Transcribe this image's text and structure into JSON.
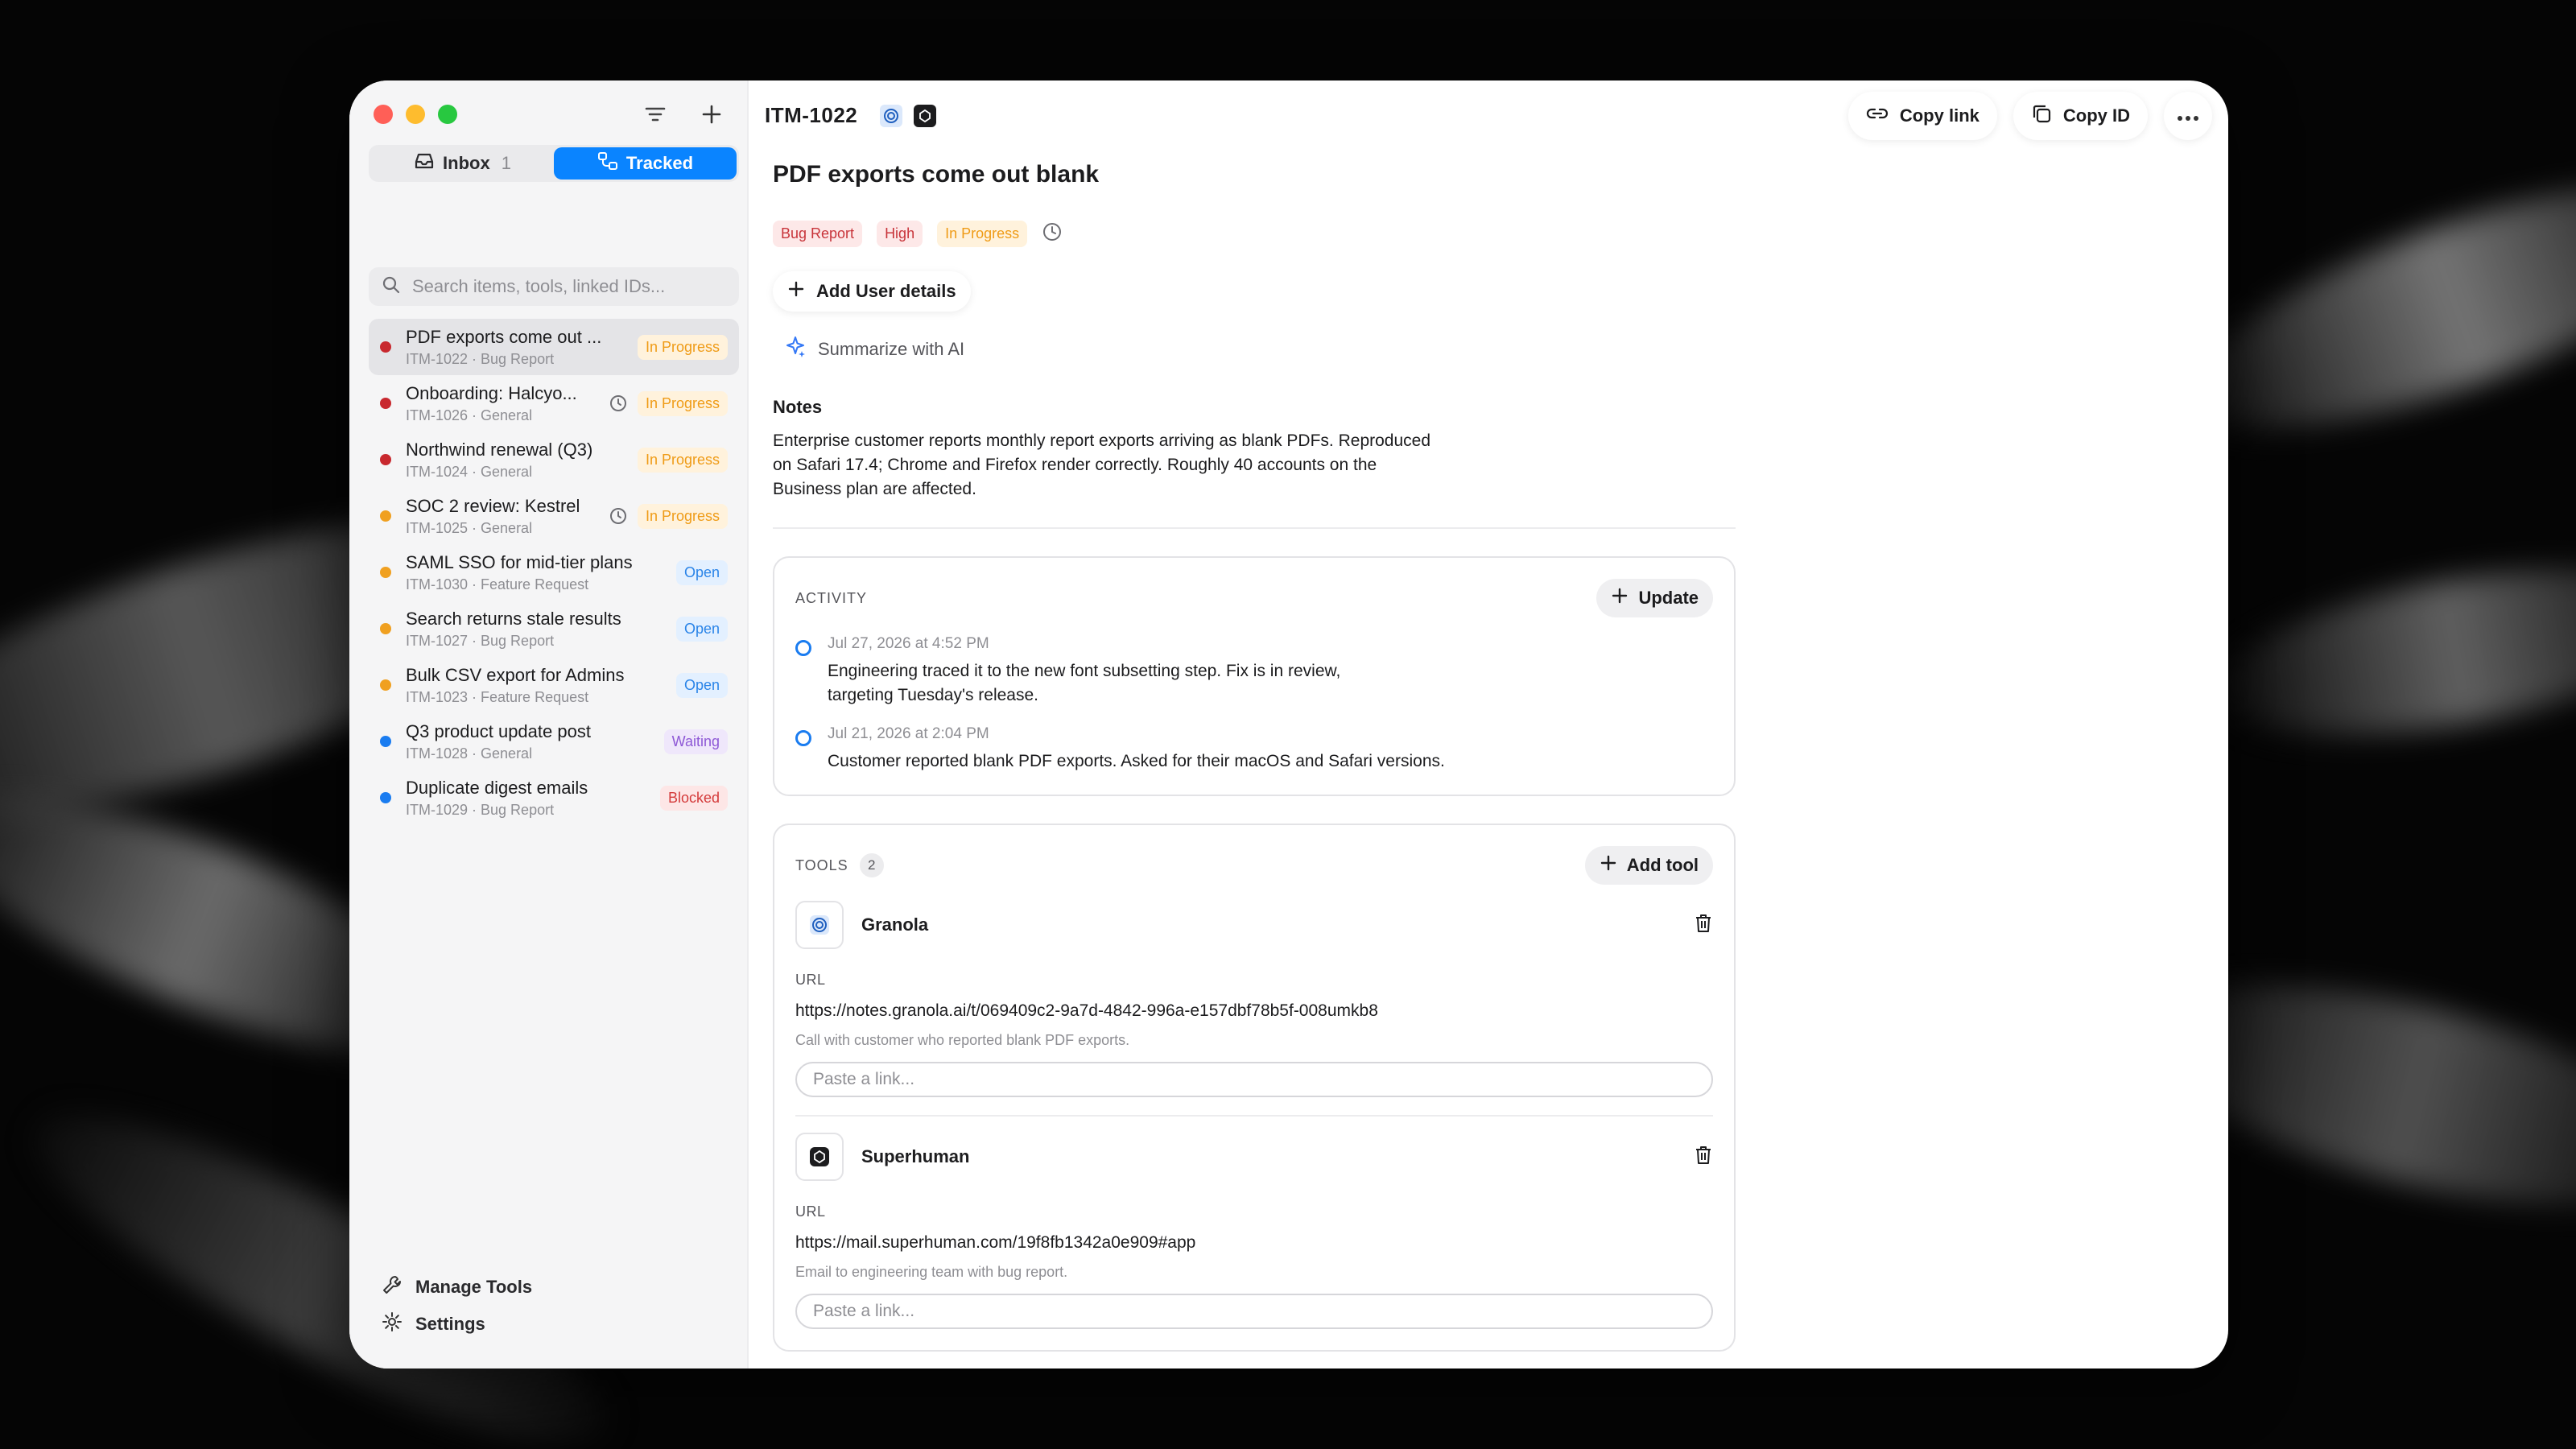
{
  "sidebar": {
    "tabs": [
      {
        "label": "Inbox",
        "count": "1"
      },
      {
        "label": "Tracked"
      }
    ],
    "search_placeholder": "Search items, tools, linked IDs...",
    "items": [
      {
        "title": "PDF exports come out ...",
        "id": "ITM-1022",
        "type": "Bug Report",
        "status": "In Progress",
        "dot": "#c8282e"
      },
      {
        "title": "Onboarding: Halcyo...",
        "id": "ITM-1026",
        "type": "General",
        "status": "In Progress",
        "dot": "#c8282e"
      },
      {
        "title": "Northwind renewal (Q3)",
        "id": "ITM-1024",
        "type": "General",
        "status": "In Progress",
        "dot": "#c8282e"
      },
      {
        "title": "SOC 2 review: Kestrel",
        "id": "ITM-1025",
        "type": "General",
        "status": "In Progress",
        "dot": "#f0a020"
      },
      {
        "title": "SAML SSO for mid-tier plans",
        "id": "ITM-1030",
        "type": "Feature Request",
        "status": "Open",
        "dot": "#f0a020"
      },
      {
        "title": "Search returns stale results",
        "id": "ITM-1027",
        "type": "Bug Report",
        "status": "Open",
        "dot": "#f0a020"
      },
      {
        "title": "Bulk CSV export for Admins",
        "id": "ITM-1023",
        "type": "Feature Request",
        "status": "Open",
        "dot": "#f0a020"
      },
      {
        "title": "Q3 product update post",
        "id": "ITM-1028",
        "type": "General",
        "status": "Waiting",
        "dot": "#1a7cf0"
      },
      {
        "title": "Duplicate digest emails",
        "id": "ITM-1029",
        "type": "Bug Report",
        "status": "Blocked",
        "dot": "#1a7cf0"
      }
    ],
    "manage_tools": "Manage Tools",
    "settings": "Settings"
  },
  "header": {
    "item_id": "ITM-1022",
    "copy_link": "Copy link",
    "copy_id": "Copy ID"
  },
  "detail": {
    "title": "PDF exports come out blank",
    "chips": [
      "Bug Report",
      "High",
      "In Progress"
    ],
    "add_user_details": "Add User details",
    "summarize": "Summarize with AI",
    "notes_heading": "Notes",
    "notes_body": "Enterprise customer reports monthly report exports arriving as blank PDFs. Reproduced on Safari 17.4; Chrome and Firefox render correctly. Roughly 40 accounts on the Business plan are affected."
  },
  "activity": {
    "heading": "ACTIVITY",
    "update_label": "Update",
    "entries": [
      {
        "when": "Jul 27, 2026 at 4:52 PM",
        "text": "Engineering traced it to the new font subsetting step. Fix is in review, targeting Tuesday's release."
      },
      {
        "when": "Jul 21, 2026 at 2:04 PM",
        "text": "Customer reported blank PDF exports. Asked for their macOS and Safari versions."
      }
    ]
  },
  "tools": {
    "heading": "TOOLS",
    "count": "2",
    "add_label": "Add tool",
    "url_label": "URL",
    "paste_placeholder": "Paste a link...",
    "items": [
      {
        "name": "Granola",
        "url": "https://notes.granola.ai/t/069409c2-9a7d-4842-996a-e157dbf78b5f-008umkb8",
        "desc": "Call with customer who reported blank PDF exports."
      },
      {
        "name": "Superhuman",
        "url": "https://mail.superhuman.com/19f8fb1342a0e909#app",
        "desc": "Email to engineering team with bug report."
      }
    ]
  }
}
